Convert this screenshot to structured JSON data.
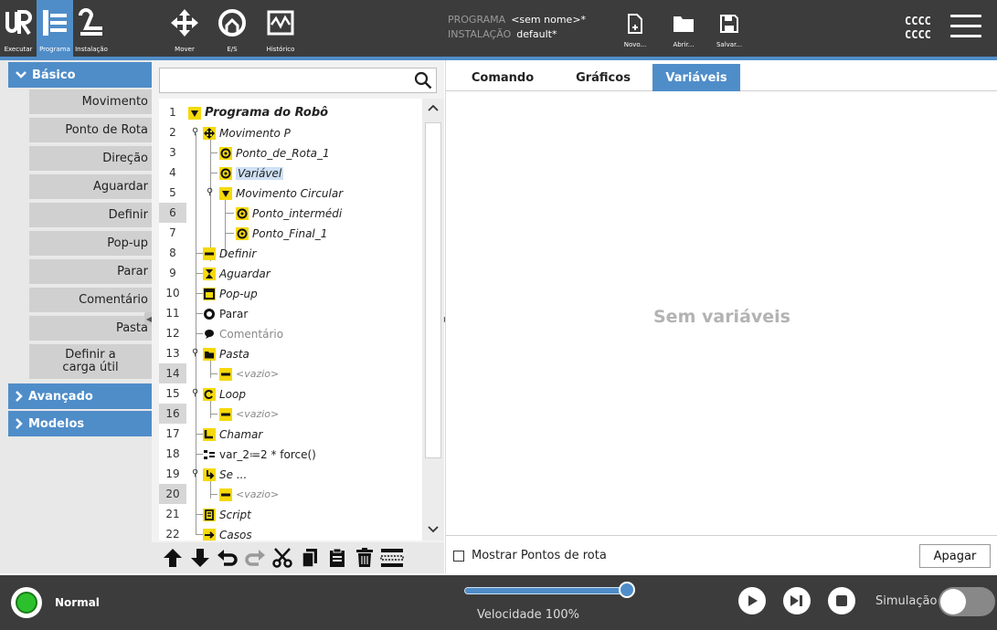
{
  "top_nav": [
    {
      "key": "run",
      "label": "Executar"
    },
    {
      "key": "program",
      "label": "Programa"
    },
    {
      "key": "install",
      "label": "Instalação"
    },
    {
      "key": "move",
      "label": "Mover"
    },
    {
      "key": "io",
      "label": "E/S"
    },
    {
      "key": "log",
      "label": "Histórico"
    }
  ],
  "program_info": {
    "program_label": "PROGRAMA",
    "program_value": "<sem nome>*",
    "install_label": "INSTALAÇÃO",
    "install_value": "default*"
  },
  "file_buttons": {
    "new": "Novo...",
    "open": "Abrir...",
    "save": "Salvar..."
  },
  "user_code": [
    "CCCC",
    "CCCC"
  ],
  "sidebar": {
    "basic": "Básico",
    "advanced": "Avançado",
    "templates": "Modelos",
    "items": [
      "Movimento",
      "Ponto de Rota",
      "Direção",
      "Aguardar",
      "Definir",
      "Pop-up",
      "Parar",
      "Comentário",
      "Pasta"
    ],
    "payload_line1": "Definir a",
    "payload_line2": "carga útil"
  },
  "tree": {
    "lines": [
      {
        "n": "1",
        "text": "Programa do Robô"
      },
      {
        "n": "2",
        "text": "Movimento P"
      },
      {
        "n": "3",
        "text": "Ponto_de_Rota_1"
      },
      {
        "n": "4",
        "text": "Variável"
      },
      {
        "n": "5",
        "text": "Movimento Circular"
      },
      {
        "n": "6",
        "text": "Ponto_intermédi"
      },
      {
        "n": "7",
        "text": "Ponto_Final_1"
      },
      {
        "n": "8",
        "text": "Definir"
      },
      {
        "n": "9",
        "text": "Aguardar"
      },
      {
        "n": "10",
        "text": "Pop-up"
      },
      {
        "n": "11",
        "text": "Parar"
      },
      {
        "n": "12",
        "text": "Comentário"
      },
      {
        "n": "13",
        "text": "Pasta"
      },
      {
        "n": "14",
        "text": "<vazio>"
      },
      {
        "n": "15",
        "text": "Loop"
      },
      {
        "n": "16",
        "text": "<vazio>"
      },
      {
        "n": "17",
        "text": "Chamar"
      },
      {
        "n": "18",
        "text": "var_2≔2 * force()"
      },
      {
        "n": "19",
        "text": "Se ..."
      },
      {
        "n": "20",
        "text": "<vazio>"
      },
      {
        "n": "21",
        "text": "Script"
      },
      {
        "n": "22",
        "text": "Casos"
      }
    ]
  },
  "tabs": [
    {
      "label": "Comando"
    },
    {
      "label": "Gráficos"
    },
    {
      "label": "Variáveis"
    }
  ],
  "right": {
    "empty_message": "Sem variáveis",
    "show_waypoints": "Mostrar Pontos de rota",
    "clear_button": "Apagar"
  },
  "footer": {
    "status": "Normal",
    "speed_label": "Velocidade 100%",
    "speed_value": 1.0,
    "simulation_label": "Simulação"
  },
  "colors": {
    "accent": "#4f8dc9",
    "topbar": "#3c3c3c",
    "node_yellow": "#f5d90a",
    "status_green": "#2cc12c"
  }
}
